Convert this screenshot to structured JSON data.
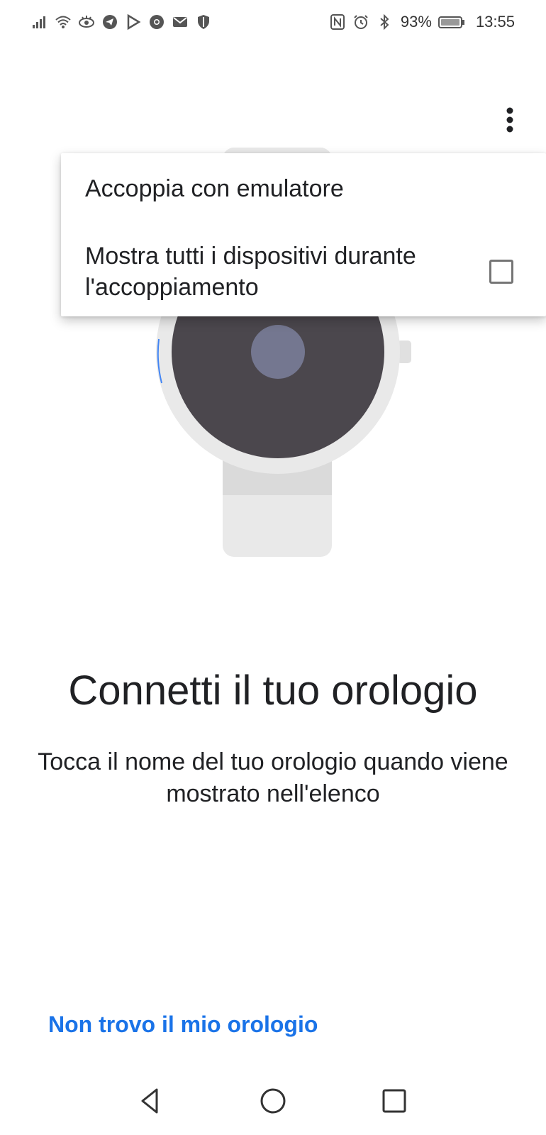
{
  "status_bar": {
    "battery": "93%",
    "time": "13:55",
    "icons_left": [
      "signal-icon",
      "wifi-icon",
      "eye-icon",
      "telegram-icon",
      "play-store-icon",
      "chrome-icon",
      "mail-icon",
      "shield-icon"
    ],
    "icons_right": [
      "nfc-icon",
      "alarm-icon",
      "bluetooth-icon",
      "battery-icon"
    ]
  },
  "menu": {
    "pair_emulator": "Accoppia con emulatore",
    "show_all_devices": "Mostra tutti i dispositivi durante l'accoppiamento",
    "show_all_checked": false
  },
  "main": {
    "title": "Connetti il tuo orologio",
    "subtitle": "Tocca il nome del tuo orologio quando viene mostrato nell'elenco",
    "cant_find_link": "Non trovo il mio orologio"
  },
  "nav_bar": {
    "back": "back-icon",
    "home": "home-icon",
    "recents": "recents-icon"
  },
  "colors": {
    "link": "#1a73e8",
    "watch_face": "#4b474d",
    "watch_center": "#747790",
    "watch_body": "#e9e9e9"
  }
}
